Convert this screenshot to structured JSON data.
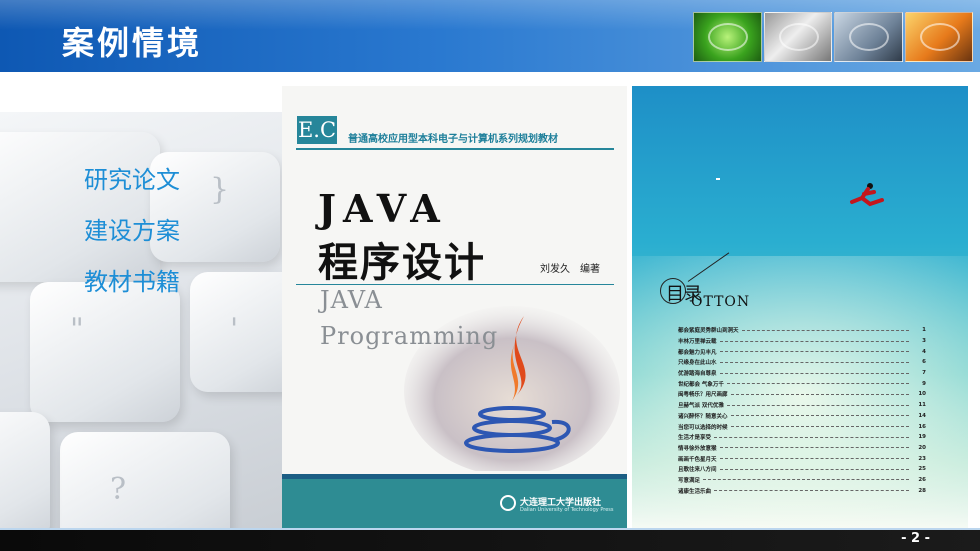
{
  "header": {
    "title": "案例情境",
    "thumbnails": [
      "green-hand-photo",
      "keyboard-photo",
      "touch-screen-photo",
      "laptop-photo"
    ]
  },
  "menu": {
    "items": [
      "研究论文",
      "建设方案",
      "教材书籍"
    ],
    "color": "#1d8ed6"
  },
  "book_cover": {
    "logo": "E.C",
    "series": "普通高校应用型本科电子与计算机系列规划教材",
    "title_en": "JAVA",
    "title_cn": "程序设计",
    "author": "刘发久　编著",
    "subtitle_line1": "JAVA",
    "subtitle_line2": "Programming",
    "publisher": "大连理工大学出版社",
    "publisher_en": "Dalian University of Technology Press",
    "accent": "#26869a"
  },
  "toc": {
    "heading": "目录",
    "heading_suffix": "OTTON",
    "entries": [
      {
        "title": "都会紫庭灵秀群山到洞天",
        "page": "1"
      },
      {
        "title": "丰林万里禅云载",
        "page": "3"
      },
      {
        "title": "都会魅力见丰凡",
        "page": "4"
      },
      {
        "title": "只缘身在此山水",
        "page": "6"
      },
      {
        "title": "优游踏海自尊泉",
        "page": "7"
      },
      {
        "title": "世纪都会 气象万千",
        "page": "9"
      },
      {
        "title": "闽粤畅乐？用尺画廊",
        "page": "10"
      },
      {
        "title": "旦赫气派 双代优雅",
        "page": "11"
      },
      {
        "title": "诸兴醉怀？随意关心",
        "page": "14"
      },
      {
        "title": "当您可以选择的时候",
        "page": "16"
      },
      {
        "title": "生活才是享受",
        "page": "19"
      },
      {
        "title": "情寻徐外放意猴",
        "page": "20"
      },
      {
        "title": "画画千色星月天",
        "page": "23"
      },
      {
        "title": "且歌往来八方间",
        "page": "25"
      },
      {
        "title": "写意满足",
        "page": "26"
      },
      {
        "title": "诸康生活乐曲",
        "page": "28"
      }
    ]
  },
  "footer": {
    "page_number": "- 2 -"
  }
}
